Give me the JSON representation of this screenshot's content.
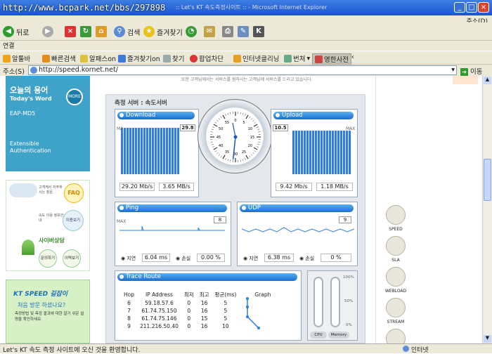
{
  "window": {
    "url_overlay": "http://www.bcpark.net/bbs/297898",
    "title": ":: Let's KT 속도측정사이트 :: - Microsoft Internet Explorer"
  },
  "menubar": {
    "help": "주소(D)"
  },
  "toolbar": {
    "back": "뒤로",
    "search": "검색",
    "favorites": "즐겨찾기"
  },
  "linkrow": {
    "label": "연결"
  },
  "favbar": {
    "items": [
      "알툴바",
      "빠른검색",
      "알패스on",
      "즐겨찾기on",
      "찾기",
      "팝업차단",
      "인터넷클리닝",
      "번쳐",
      "영한사전"
    ]
  },
  "address": {
    "label": "주소(S)",
    "url": "http://speed.kornet.net/",
    "go": "이동"
  },
  "left": {
    "term_title": "오늘의 용어",
    "term_sub": "Today's Word",
    "more": "MORE",
    "term": "EAP-MD5",
    "term_desc": "Extensible Authentication",
    "faq": "FAQ",
    "faq_text": "고객께서 자주하시는 질문",
    "how": "속도 이용 정보안내",
    "how_btn": "이용보기",
    "cyber": "사이버상담",
    "ask": "문의하기",
    "hist": "이력보기",
    "guide_title": "KT SPEED 길잡이",
    "guide_q": "처음 방문 하셨나요?",
    "guide_desc": "측정방법 및 측정 결과에 대한 알기 쉬운 설명을 확인하세요."
  },
  "main": {
    "top_text": "또한 고객님께서는 서비스를 원하시는 고객님께 서비스를 드리고 있습니다.",
    "server": "측정 서버 : 속도서버",
    "download": {
      "title": "Download",
      "peak": "29.8",
      "v1": "29.20 Mb/s",
      "v2": "3.65 MB/s",
      "level": 0.88
    },
    "upload": {
      "title": "Upload",
      "peak": "10.5",
      "v1": "9.42 Mb/s",
      "v2": "1.18 MB/s",
      "level": 0.82
    },
    "ping": {
      "title": "Ping",
      "max": "8",
      "lag_label": "지연",
      "lag": "6.04 ms",
      "loss_label": "손실",
      "loss": "0.00 %"
    },
    "udp": {
      "title": "UDP",
      "max": "9",
      "lag_label": "지연",
      "lag": "6.38 ms",
      "loss_label": "손실",
      "loss": "0 %"
    },
    "gauge": {
      "ticks": [
        "0",
        "5",
        "10",
        "15",
        "20",
        "25",
        "30",
        "35",
        "40",
        "45",
        "50",
        "55",
        "60"
      ]
    },
    "trace": {
      "title": "Trace Route",
      "headers": [
        "Hop",
        "IP Address",
        "최저",
        "최고",
        "평균(ms)",
        "Graph"
      ],
      "rows": [
        [
          "6",
          "59.18.57.6",
          "0",
          "16",
          "5"
        ],
        [
          "7",
          "61.74.75.150",
          "0",
          "16",
          "5"
        ],
        [
          "8",
          "61.74.75.146",
          "0",
          "15",
          "5"
        ],
        [
          "9",
          "211.216.50.40",
          "0",
          "16",
          "10"
        ]
      ]
    },
    "meters": {
      "cpu": "CPU",
      "memory": "Memory",
      "p100": "100%",
      "p50": "50%",
      "p0": "0%"
    }
  },
  "right": {
    "icons": [
      "SPEED",
      "SLA",
      "WEBLOAD",
      "STREAM"
    ]
  },
  "status": {
    "text": "Let's KT 속도 측정 사이트에 오신 것을 환영합니다.",
    "zone": "인터넷"
  }
}
